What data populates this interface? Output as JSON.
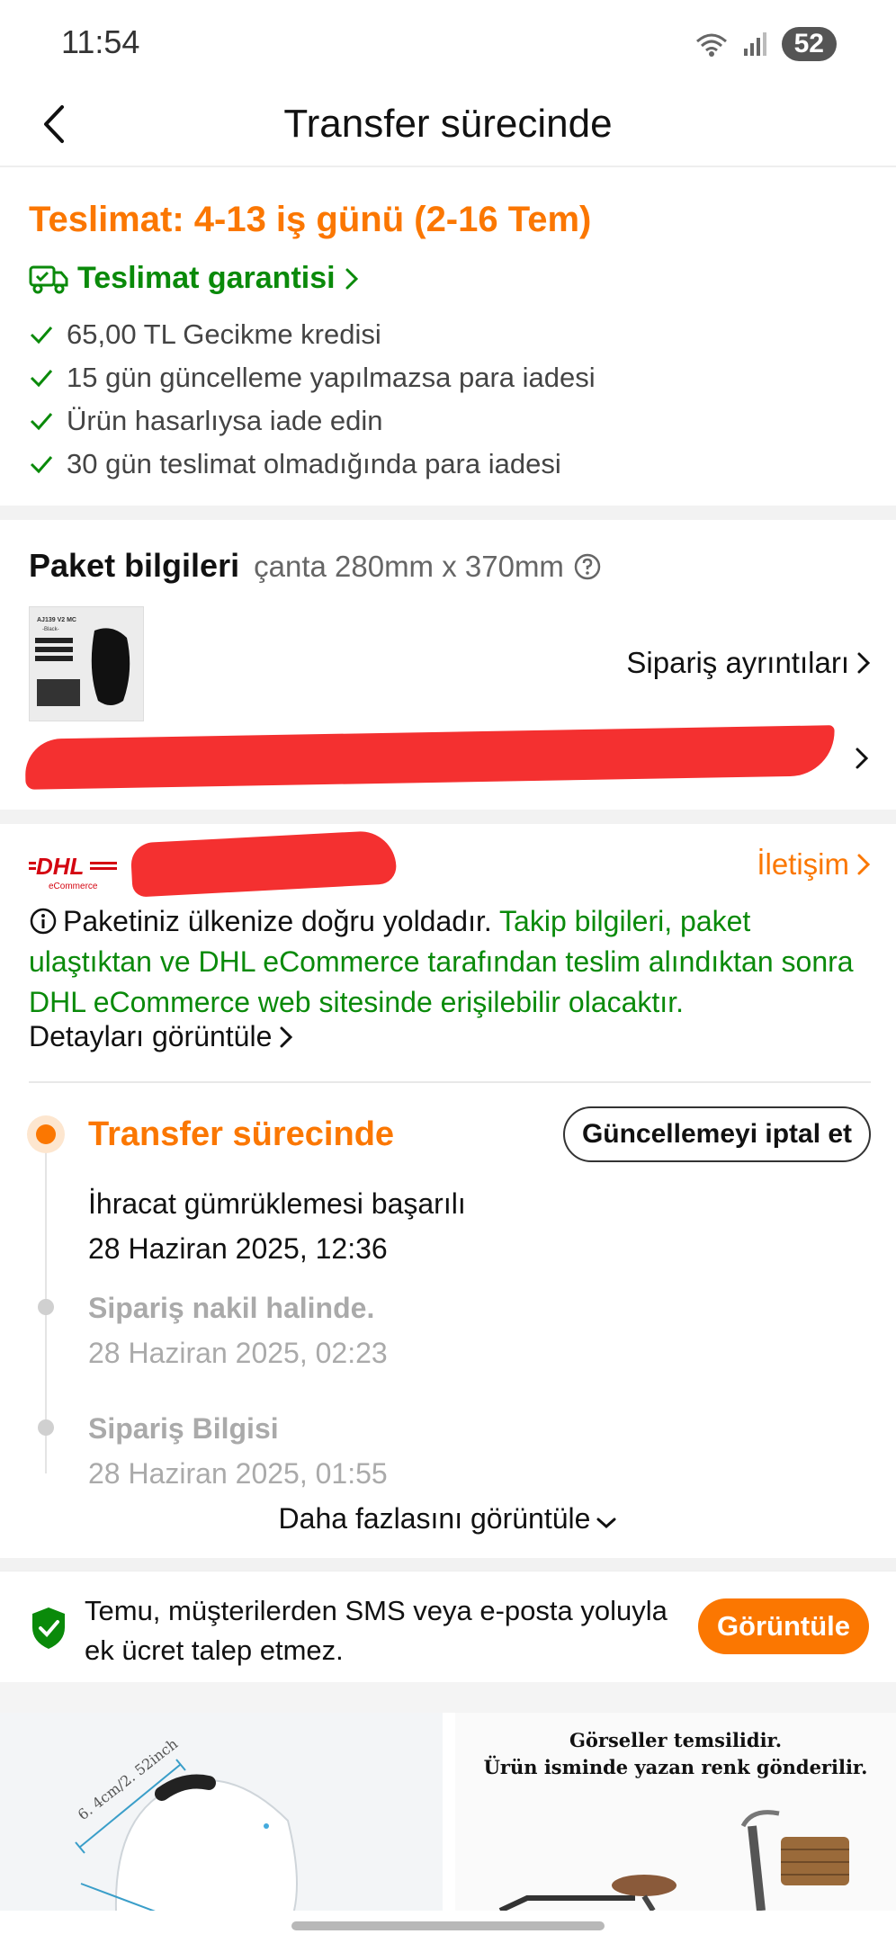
{
  "status": {
    "time": "11:54",
    "battery": "52"
  },
  "nav": {
    "title": "Transfer sürecinde"
  },
  "delivery": {
    "title": "Teslimat: 4-13 iş günü (2-16 Tem)",
    "guarantee": "Teslimat garantisi",
    "checks": [
      "65,00 TL Gecikme kredisi",
      "15 gün güncelleme yapılmazsa para iadesi",
      "Ürün hasarlıysa iade edin",
      "30 gün teslimat olmadığında para iadesi"
    ]
  },
  "package": {
    "title": "Paket bilgileri",
    "subtitle": "çanta 280mm x 370mm",
    "order_details": "Sipariş ayrıntıları",
    "thumb_text": [
      "AJ139 V2 MC",
      "-Black-"
    ]
  },
  "carrier": {
    "logo": "DHL",
    "logo_sub": "eCommerce",
    "contact": "İletişim",
    "info_plain": "Paketiniz ülkenize doğru yoldadır.",
    "info_green": "Takip bilgileri, paket ulaştıktan ve DHL eCommerce tarafından teslim alındıktan sonra DHL eCommerce web sitesinde erişilebilir olacaktır.",
    "view_details": "Detayları görüntüle"
  },
  "timeline": {
    "cancel_button": "Güncellemeyi iptal et",
    "current": {
      "status": "Transfer sürecinde",
      "text": "İhracat gümrüklemesi başarılı",
      "date": "28 Haziran 2025, 12:36"
    },
    "events": [
      {
        "status": "Sipariş nakil halinde.",
        "date": "28 Haziran 2025, 02:23"
      },
      {
        "status": "Sipariş Bilgisi",
        "date": "28 Haziran 2025, 01:55"
      }
    ],
    "more": "Daha fazlasını görüntüle"
  },
  "sms": {
    "text": "Temu, müşterilerden SMS veya e-posta yoluyla ek ücret talep etmez.",
    "button": "Görüntüle"
  },
  "products": {
    "p1_dimension": "6. 4cm/2. 52inch",
    "p2_caption_line1": "Görseller temsilidir.",
    "p2_caption_line2": "Ürün isminde yazan renk gönderilir."
  },
  "colors": {
    "accent": "#fb7701",
    "green": "#0a8a0a",
    "redaction": "#f43030"
  }
}
